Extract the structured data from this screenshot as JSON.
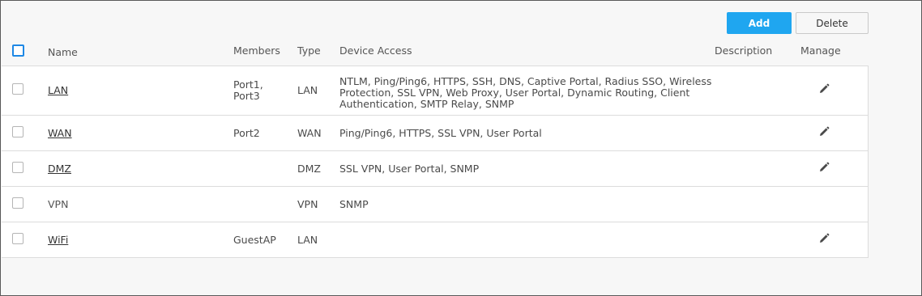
{
  "toolbar": {
    "add_label": "Add",
    "delete_label": "Delete"
  },
  "columns": {
    "name": "Name",
    "members": "Members",
    "type": "Type",
    "device_access": "Device Access",
    "description": "Description",
    "manage": "Manage"
  },
  "rows": [
    {
      "name": "LAN",
      "members": "Port1,\nPort3",
      "type": "LAN",
      "device_access": "NTLM, Ping/Ping6, HTTPS, SSH, DNS, Captive Portal, Radius SSO, Wireless Protection, SSL VPN, Web Proxy, User Portal, Dynamic Routing, Client Authentication, SMTP Relay, SNMP",
      "description": "",
      "editable": true,
      "linked": true
    },
    {
      "name": "WAN",
      "members": "Port2",
      "type": "WAN",
      "device_access": "Ping/Ping6, HTTPS, SSL VPN, User Portal",
      "description": "",
      "editable": true,
      "linked": true
    },
    {
      "name": "DMZ",
      "members": "",
      "type": "DMZ",
      "device_access": "SSL VPN, User Portal, SNMP",
      "description": "",
      "editable": true,
      "linked": true
    },
    {
      "name": "VPN",
      "members": "",
      "type": "VPN",
      "device_access": "SNMP",
      "description": "",
      "editable": false,
      "linked": false
    },
    {
      "name": "WiFi",
      "members": "GuestAP",
      "type": "LAN",
      "device_access": "",
      "description": "",
      "editable": true,
      "linked": true
    }
  ],
  "icons": {
    "row_edit": "pencil-icon"
  },
  "colors": {
    "accent": "#1fa6f0",
    "checkbox_header": "#1e88e5"
  }
}
